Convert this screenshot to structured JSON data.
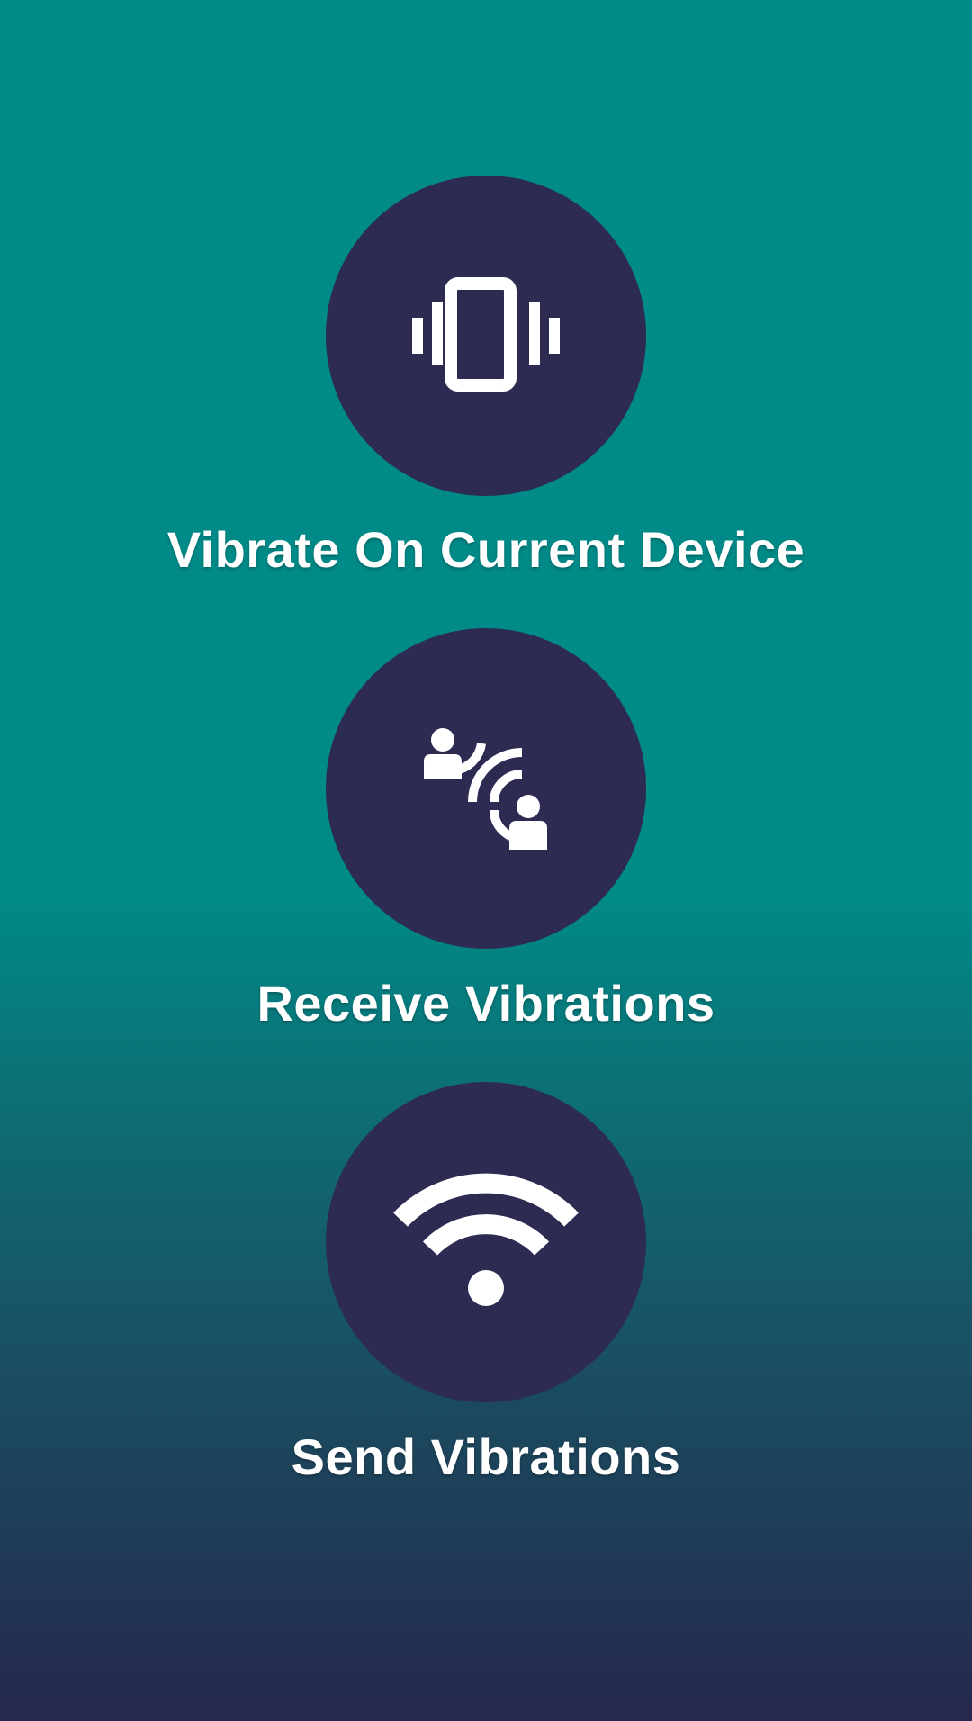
{
  "screen": {
    "background_colors": [
      "#008a88",
      "#0f6a72",
      "#1a4d60",
      "#26284c"
    ],
    "button_color": "#2d2b52",
    "icon_color": "#ffffff"
  },
  "actions": [
    {
      "label": "Vibrate On Current Device",
      "icon": "phone-vibrate-icon"
    },
    {
      "label": "Receive Vibrations",
      "icon": "connected-users-icon"
    },
    {
      "label": "Send Vibrations",
      "icon": "wifi-signal-icon"
    }
  ]
}
